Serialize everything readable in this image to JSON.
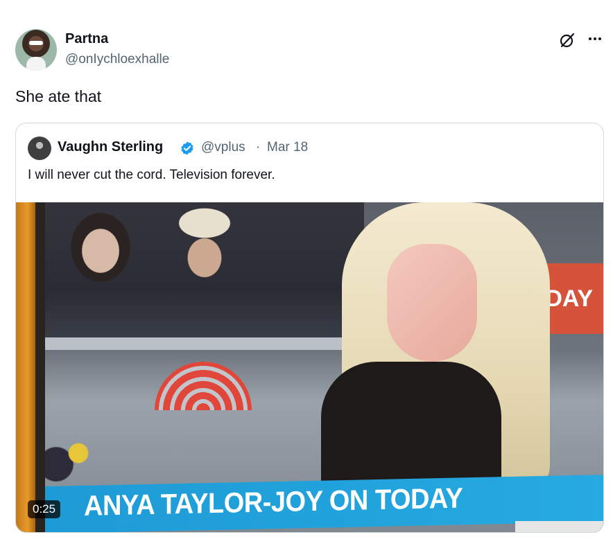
{
  "post": {
    "author_name": "Partna",
    "author_handle": "@onIychloexhalle",
    "text": "She ate that",
    "icons": [
      "grok-icon",
      "more-icon"
    ]
  },
  "quoted_post": {
    "author_name": "Vaughn Sterling",
    "verified": true,
    "handle": "@vplus",
    "separator": "·",
    "date": "Mar 18",
    "text": "I will never cut the cord. Television forever.",
    "video": {
      "caption": "ANYA TAYLOR-JOY ON TODAY",
      "sign_text": "DAY",
      "duration": "0:25"
    }
  },
  "colors": {
    "text_primary": "#0f1419",
    "text_secondary": "#536471",
    "verified_blue": "#1d9bf0",
    "border": "#cfd9de",
    "lower_third_blue": "#1d9bd6"
  }
}
